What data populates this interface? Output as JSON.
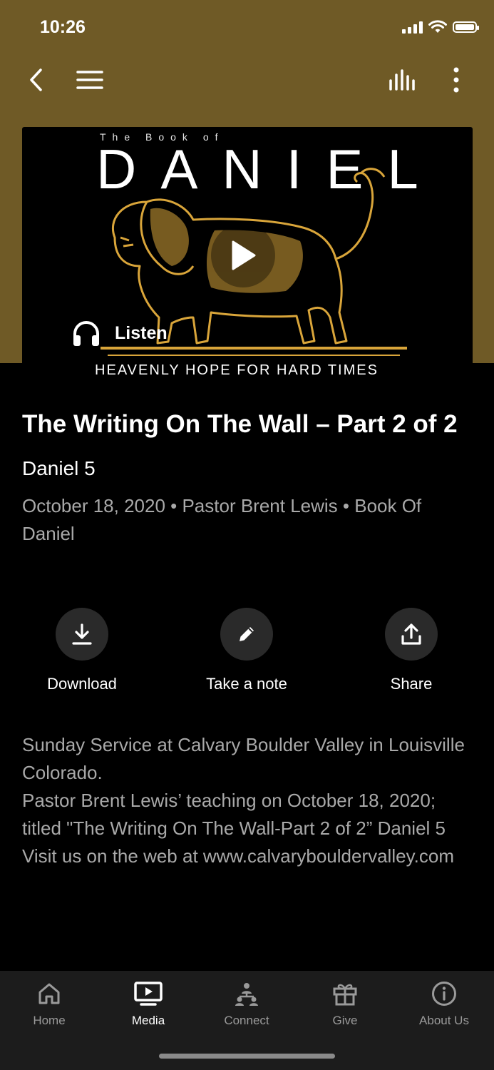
{
  "status_bar": {
    "time": "10:26"
  },
  "navbar": {
    "back_icon": "chevron-left-icon",
    "menu_icon": "hamburger-menu-icon",
    "audio_icon": "audio-bars-icon",
    "more_icon": "vertical-ellipsis-icon"
  },
  "hero": {
    "kicker": "The Book of",
    "title": "DANIEL",
    "tagline": "HEAVENLY HOPE FOR HARD TIMES",
    "listen_label": "Listen",
    "play_icon": "play-icon",
    "headphones_icon": "headphones-icon"
  },
  "sermon": {
    "title": "The Writing On The Wall – Part 2 of 2",
    "scripture": "Daniel 5",
    "meta": "October 18, 2020 • Pastor Brent Lewis • Book Of Daniel"
  },
  "actions": [
    {
      "label": "Download",
      "icon": "download-icon"
    },
    {
      "label": "Take a note",
      "icon": "pencil-icon"
    },
    {
      "label": "Share",
      "icon": "share-icon"
    }
  ],
  "description": [
    "Sunday Service at Calvary Boulder Valley in Louisville Colorado.",
    "Pastor Brent Lewis’ teaching on October 18, 2020; titled \"The Writing On The Wall-Part 2 of 2”  Daniel 5",
    "Visit us on the web at www.calvarybouldervalley.com"
  ],
  "tabs": [
    {
      "label": "Home",
      "icon": "home-icon",
      "active": false
    },
    {
      "label": "Media",
      "icon": "media-tv-icon",
      "active": true
    },
    {
      "label": "Connect",
      "icon": "connect-people-icon",
      "active": false
    },
    {
      "label": "Give",
      "icon": "gift-icon",
      "active": false
    },
    {
      "label": "About Us",
      "icon": "info-icon",
      "active": false
    }
  ],
  "colors": {
    "header_background": "#6f5a26",
    "art_gold": "#d9a53a",
    "page_background": "#000000",
    "tabbar_background": "#1c1c1c"
  }
}
